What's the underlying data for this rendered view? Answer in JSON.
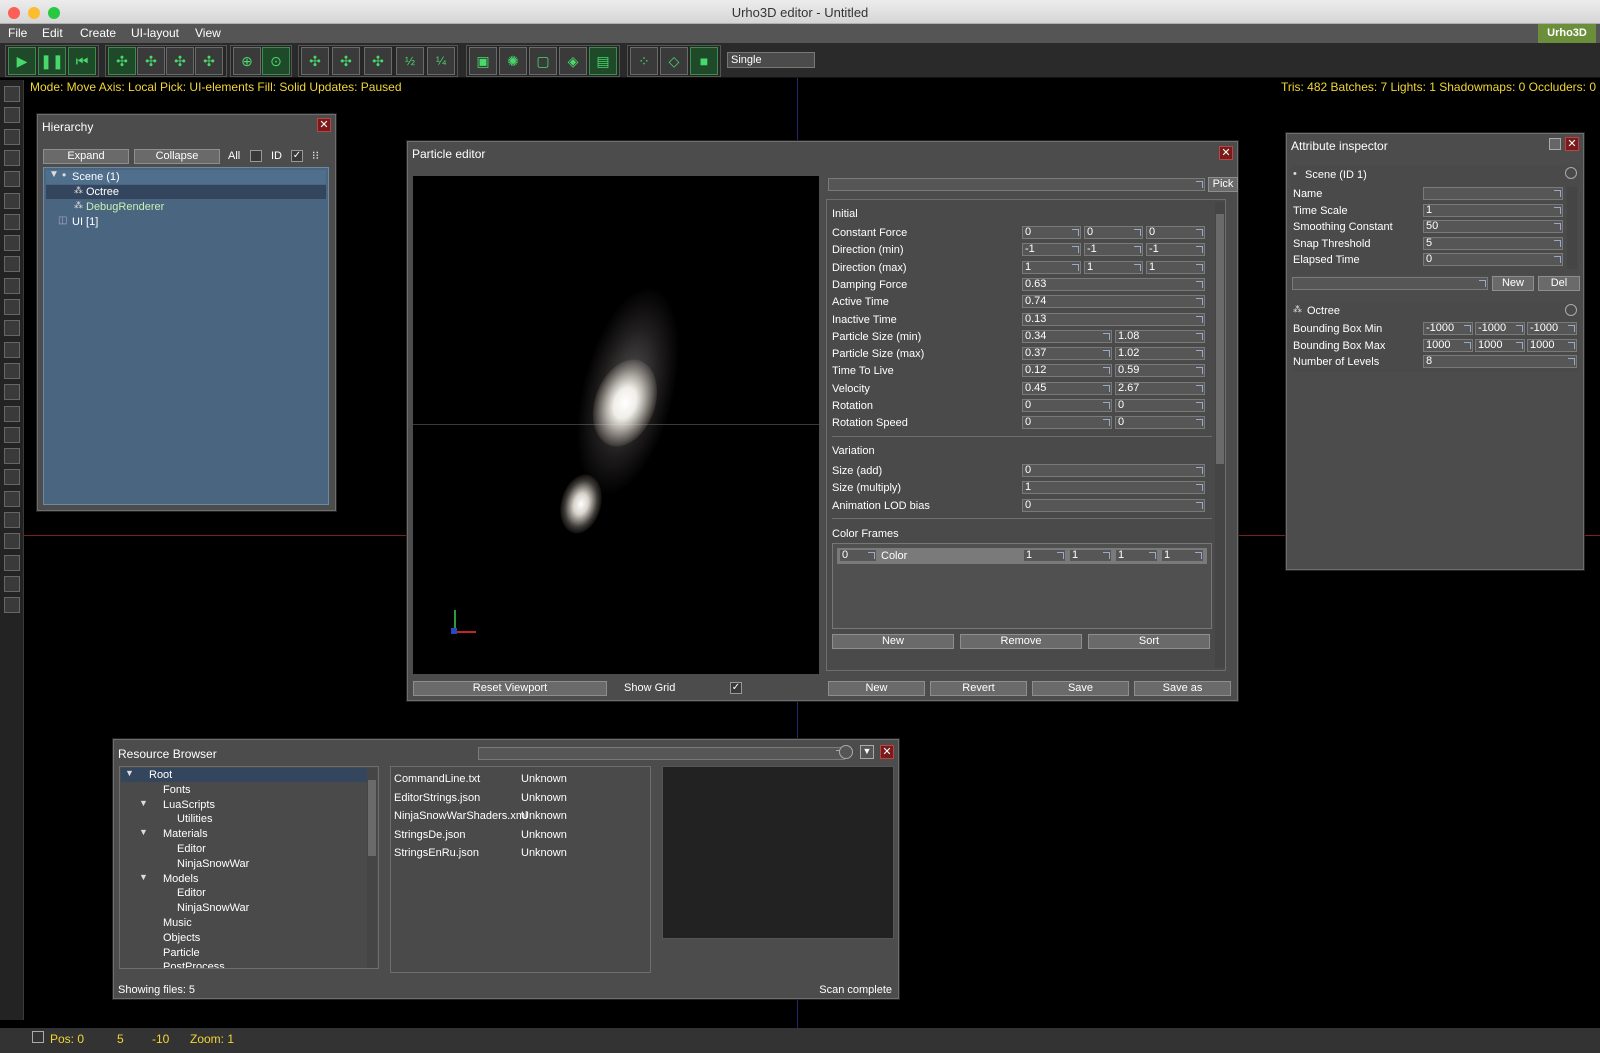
{
  "window": {
    "title": "Urho3D editor - Untitled",
    "logo": "Urho3D"
  },
  "menu": [
    "File",
    "Edit",
    "Create",
    "UI-layout",
    "View"
  ],
  "toolbar": {
    "mode_select": "Single"
  },
  "status": {
    "line": "Mode: Move  Axis: Local  Pick: UI-elements  Fill: Solid  Updates: Paused",
    "stats": "Tris: 482  Batches: 7  Lights: 1  Shadowmaps: 0  Occluders: 0"
  },
  "hierarchy": {
    "title": "Hierarchy",
    "expand": "Expand",
    "collapse": "Collapse",
    "all": "All",
    "id": "ID",
    "items": [
      "Scene (1)",
      "Octree",
      "DebugRenderer",
      "UI [1]"
    ]
  },
  "particle": {
    "title": "Particle editor",
    "pick": "Pick",
    "reset": "Reset Viewport",
    "show_grid": "Show Grid",
    "section_initial": "Initial",
    "rows": [
      {
        "label": "Constant Force",
        "v": [
          "0",
          "0",
          "0"
        ]
      },
      {
        "label": "Direction (min)",
        "v": [
          "-1",
          "-1",
          "-1"
        ]
      },
      {
        "label": "Direction (max)",
        "v": [
          "1",
          "1",
          "1"
        ]
      },
      {
        "label": "Damping Force",
        "v": [
          "0.63"
        ]
      },
      {
        "label": "Active Time",
        "v": [
          "0.74"
        ]
      },
      {
        "label": "Inactive Time",
        "v": [
          "0.13"
        ]
      },
      {
        "label": "Particle Size (min)",
        "v": [
          "0.34",
          "1.08"
        ]
      },
      {
        "label": "Particle Size (max)",
        "v": [
          "0.37",
          "1.02"
        ]
      },
      {
        "label": "Time To Live",
        "v": [
          "0.12",
          "0.59"
        ]
      },
      {
        "label": "Velocity",
        "v": [
          "0.45",
          "2.67"
        ]
      },
      {
        "label": "Rotation",
        "v": [
          "0",
          "0"
        ]
      },
      {
        "label": "Rotation Speed",
        "v": [
          "0",
          "0"
        ]
      }
    ],
    "section_variation": "Variation",
    "var_rows": [
      {
        "label": "Size (add)",
        "v": [
          "0"
        ]
      },
      {
        "label": "Size (multiply)",
        "v": [
          "1"
        ]
      },
      {
        "label": "Animation LOD bias",
        "v": [
          "0"
        ]
      }
    ],
    "section_color": "Color Frames",
    "color_frame": {
      "time": "0",
      "label": "Color",
      "rgba": [
        "1",
        "1",
        "1",
        "1"
      ]
    },
    "cf_buttons": [
      "New",
      "Remove",
      "Sort"
    ],
    "bottom_buttons": [
      "New",
      "Revert",
      "Save",
      "Save as"
    ]
  },
  "inspector": {
    "title": "Attribute inspector",
    "scene": "Scene (ID 1)",
    "scene_attrs": [
      {
        "label": "Name",
        "v": ""
      },
      {
        "label": "Time Scale",
        "v": "1"
      },
      {
        "label": "Smoothing Constant",
        "v": "50"
      },
      {
        "label": "Snap Threshold",
        "v": "5"
      },
      {
        "label": "Elapsed Time",
        "v": "0"
      }
    ],
    "new": "New",
    "del": "Del",
    "octree": "Octree",
    "octree_attrs": [
      {
        "label": "Bounding Box Min",
        "v": [
          "-1000",
          "-1000",
          "-1000"
        ]
      },
      {
        "label": "Bounding Box Max",
        "v": [
          "1000",
          "1000",
          "1000"
        ]
      },
      {
        "label": "Number of Levels",
        "v": [
          "8"
        ]
      }
    ]
  },
  "resource": {
    "title": "Resource Browser",
    "tree": [
      {
        "label": "Root",
        "d": 0,
        "exp": true
      },
      {
        "label": "Fonts",
        "d": 1
      },
      {
        "label": "LuaScripts",
        "d": 1,
        "exp": true
      },
      {
        "label": "Utilities",
        "d": 2
      },
      {
        "label": "Materials",
        "d": 1,
        "exp": true
      },
      {
        "label": "Editor",
        "d": 2
      },
      {
        "label": "NinjaSnowWar",
        "d": 2
      },
      {
        "label": "Models",
        "d": 1,
        "exp": true
      },
      {
        "label": "Editor",
        "d": 2
      },
      {
        "label": "NinjaSnowWar",
        "d": 2
      },
      {
        "label": "Music",
        "d": 1
      },
      {
        "label": "Objects",
        "d": 1
      },
      {
        "label": "Particle",
        "d": 1
      },
      {
        "label": "PostProcess",
        "d": 1
      }
    ],
    "files": [
      {
        "name": "CommandLine.txt",
        "type": "Unknown"
      },
      {
        "name": "EditorStrings.json",
        "type": "Unknown"
      },
      {
        "name": "NinjaSnowWarShaders.xml",
        "type": "Unknown"
      },
      {
        "name": "StringsDe.json",
        "type": "Unknown"
      },
      {
        "name": "StringsEnRu.json",
        "type": "Unknown"
      }
    ],
    "showing": "Showing files: 5",
    "scan": "Scan complete"
  },
  "bottom": {
    "pos": "Pos: 0",
    "y": "5",
    "z": "-10",
    "zoom": "Zoom: 1"
  }
}
